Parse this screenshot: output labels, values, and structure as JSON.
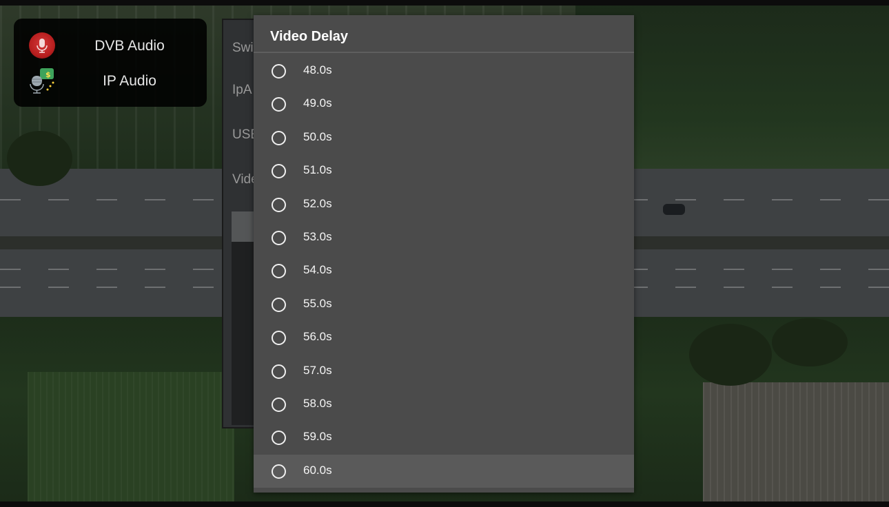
{
  "audio_panel": {
    "items": [
      {
        "label": "DVB Audio",
        "icon": "microphone-red-icon"
      },
      {
        "label": "IP Audio",
        "icon": "microphone-ip-icon"
      }
    ]
  },
  "settings_panel": {
    "items": [
      "Swi",
      "IpA",
      "USE",
      "Vide"
    ]
  },
  "dialog": {
    "title": "Video Delay",
    "options": [
      "48.0s",
      "49.0s",
      "50.0s",
      "51.0s",
      "52.0s",
      "53.0s",
      "54.0s",
      "55.0s",
      "56.0s",
      "57.0s",
      "58.0s",
      "59.0s",
      "60.0s"
    ],
    "focused": "60.0s"
  }
}
